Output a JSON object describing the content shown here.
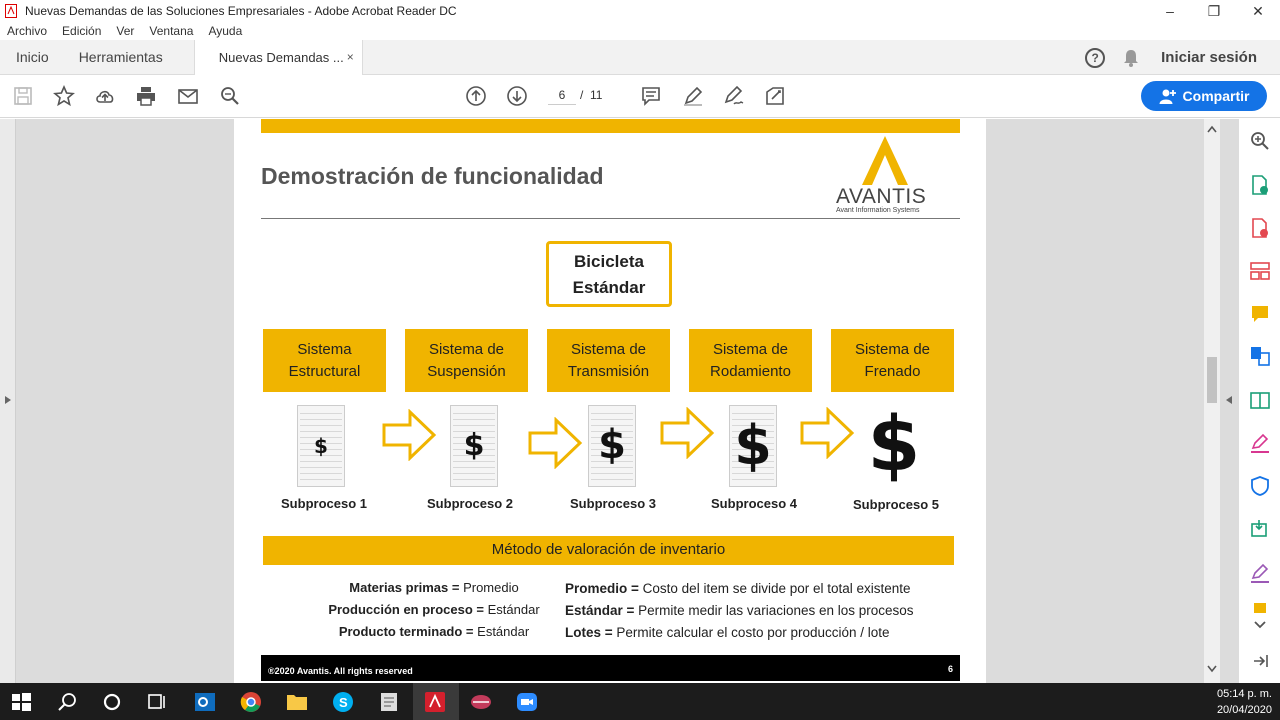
{
  "window": {
    "title": "Nuevas Demandas de las Soluciones Empresariales - Adobe Acrobat Reader DC",
    "controls": [
      "–",
      "❐",
      "✕"
    ]
  },
  "menu": [
    "Archivo",
    "Edición",
    "Ver",
    "Ventana",
    "Ayuda"
  ],
  "tabs": {
    "home": "Inicio",
    "tools": "Herramientas",
    "document": "Nuevas Demandas ...",
    "close": "×",
    "signin": "Iniciar sesión",
    "help": "?"
  },
  "toolbar": {
    "page_current": "6",
    "page_separator": "/",
    "page_total": "11",
    "share_label": "Compartir"
  },
  "slide": {
    "title": "Demostración de funcionalidad",
    "logo_word": "AVANTIS",
    "logo_sub": "Avant Information Systems",
    "product": [
      "Bicicleta",
      "Estándar"
    ],
    "systems": [
      [
        "Sistema",
        "Estructural"
      ],
      [
        "Sistema de",
        "Suspensión"
      ],
      [
        "Sistema de",
        "Transmisión"
      ],
      [
        "Sistema de",
        "Rodamiento"
      ],
      [
        "Sistema de",
        "Frenado"
      ]
    ],
    "subprocesses": [
      "Subproceso 1",
      "Subproceso 2",
      "Subproceso 3",
      "Subproceso 4",
      "Subproceso 5"
    ],
    "dollar": "$",
    "method_title": "Método de valoración de inventario",
    "left_items": [
      {
        "label": "Materias primas =",
        "value": " Promedio"
      },
      {
        "label": "Producción en proceso =",
        "value": " Estándar"
      },
      {
        "label": "Producto terminado =",
        "value": " Estándar"
      }
    ],
    "right_items": [
      {
        "label": "Promedio =",
        "value": " Costo del item se divide por el total existente"
      },
      {
        "label": "Estándar =",
        "value": " Permite medir las variaciones en los procesos"
      },
      {
        "label": "Lotes =",
        "value": " Permite calcular el costo por producción / lote"
      }
    ],
    "footer_copy": "®2020 Avantis. All rights reserved",
    "footer_page": "6"
  },
  "taskbar": {
    "time": "05:14 p. m.",
    "date": "20/04/2020"
  },
  "colors": {
    "gold": "#f0b400",
    "share_blue": "#1473e6"
  }
}
